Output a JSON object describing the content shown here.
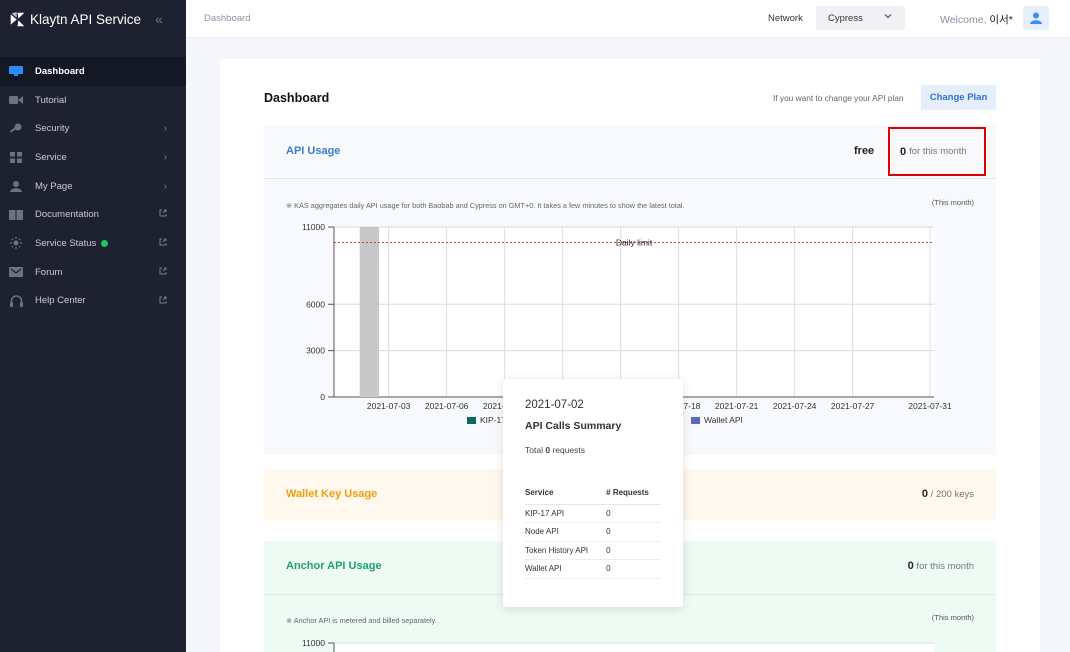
{
  "sidebar": {
    "brand": "Klaytn API Service",
    "items": [
      {
        "label": "Dashboard",
        "icon": "dashboard-icon",
        "active": true
      },
      {
        "label": "Tutorial",
        "icon": "video-icon"
      },
      {
        "label": "Security",
        "icon": "key-icon",
        "trail": "chevron"
      },
      {
        "label": "Service",
        "icon": "grid-icon",
        "trail": "chevron"
      },
      {
        "label": "My Page",
        "icon": "user-icon",
        "trail": "chevron"
      },
      {
        "label": "Documentation",
        "icon": "book-icon",
        "trail": "external"
      },
      {
        "label": "Service Status",
        "icon": "sun-icon",
        "trail": "external",
        "status": "online"
      },
      {
        "label": "Forum",
        "icon": "forum-icon",
        "trail": "external"
      },
      {
        "label": "Help Center",
        "icon": "headset-icon",
        "trail": "external"
      }
    ]
  },
  "header": {
    "breadcrumb": "Dashboard",
    "network_label": "Network",
    "network_value": "Cypress",
    "welcome": "Welcome, ",
    "user": "이서*"
  },
  "dashboard": {
    "title": "Dashboard",
    "plan_hint": "If you want to change your API plan",
    "change_plan": "Change Plan"
  },
  "api_usage": {
    "title": "API Usage",
    "plan": "free",
    "count": "0",
    "period": " for this month",
    "note": "※ KAS aggregates daily API usage for both Baobab and Cypress on GMT+0. It takes a few minutes to show the latest total.",
    "this_month": "(This month)"
  },
  "chart_data": {
    "type": "bar",
    "y_ticks": [
      "0",
      "3000",
      "6000",
      "11000"
    ],
    "ylim": [
      0,
      11000
    ],
    "x_ticks": [
      "2021-07-03",
      "2021-07-06",
      "2021-07-09",
      "2021-07-12",
      "2021-07-15",
      "2021-07-18",
      "2021-07-21",
      "2021-07-24",
      "2021-07-27",
      "2021-07-31"
    ],
    "x_range": [
      "2021-07-01",
      "2021-07-31"
    ],
    "limit_label": "Daily limit",
    "limit_value": 10000,
    "highlight_date": "2021-07-02",
    "legend": [
      "KIP-17 API",
      "Node API",
      "Token History API",
      "Wallet API"
    ],
    "legend_colors": [
      "#0a6b5e",
      "#8bc34a",
      "#f6a623",
      "#5b6abf"
    ],
    "series": [
      {
        "name": "KIP-17 API",
        "values": []
      },
      {
        "name": "Node API",
        "values": []
      },
      {
        "name": "Token History API",
        "values": []
      },
      {
        "name": "Wallet API",
        "values": []
      }
    ],
    "grid": true
  },
  "tooltip": {
    "date": "2021-07-02",
    "subtitle": "API Calls Summary",
    "total_prefix": "Total ",
    "total_value": "0",
    "total_suffix": " requests",
    "col_service": "Service",
    "col_requests": "# Requests",
    "rows": [
      {
        "service": "KIP-17 API",
        "requests": "0"
      },
      {
        "service": "Node API",
        "requests": "0"
      },
      {
        "service": "Token History API",
        "requests": "0"
      },
      {
        "service": "Wallet API",
        "requests": "0"
      }
    ]
  },
  "wallet_key": {
    "title": "Wallet Key Usage",
    "count": "0",
    "suffix": " / 200 keys"
  },
  "anchor": {
    "title": "Anchor API Usage",
    "count": "0",
    "period": " for this month",
    "note": "※ Anchor API is metered and billed separately.",
    "this_month": "(This month)",
    "y_top_tick": "11000"
  },
  "colors": {
    "sidebar_bg": "#1e2230",
    "accent_blue": "#3a7bd5",
    "wallet_orange": "#f29d0b",
    "anchor_green": "#1ea36a",
    "limit_red": "#e53935",
    "highlight_red": "#e00000"
  }
}
